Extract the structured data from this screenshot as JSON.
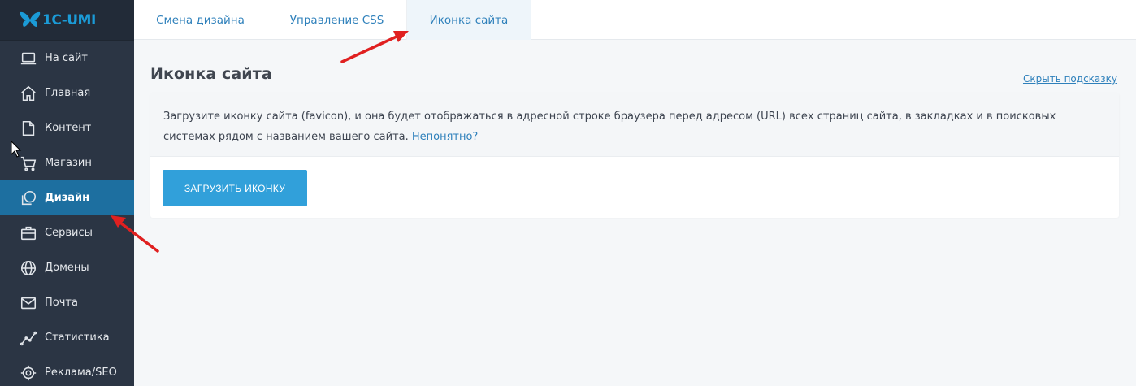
{
  "app": {
    "logo_text": "1C-UMI"
  },
  "sidebar": {
    "items": [
      {
        "label": "На сайт",
        "icon": "laptop-icon"
      },
      {
        "label": "Главная",
        "icon": "home-icon"
      },
      {
        "label": "Контент",
        "icon": "document-icon"
      },
      {
        "label": "Магазин",
        "icon": "cart-icon"
      },
      {
        "label": "Дизайн",
        "icon": "design-icon",
        "active": true
      },
      {
        "label": "Сервисы",
        "icon": "briefcase-icon"
      },
      {
        "label": "Домены",
        "icon": "globe-icon"
      },
      {
        "label": "Почта",
        "icon": "mail-icon"
      },
      {
        "label": "Статистика",
        "icon": "chart-line-icon"
      },
      {
        "label": "Реклама/SEO",
        "icon": "target-icon"
      }
    ]
  },
  "tabs": [
    {
      "label": "Смена дизайна"
    },
    {
      "label": "Управление CSS"
    },
    {
      "label": "Иконка сайта",
      "active": true
    }
  ],
  "main": {
    "title": "Иконка сайта",
    "hide_hint": "Скрыть подсказку",
    "hint_text": "Загрузите иконку сайта (favicon), и она будет отображаться в адресной строке браузера перед адресом (URL) всех страниц сайта, в закладках и в поисковых системах рядом с названием вашего сайта.",
    "hint_link": "Непонятно?",
    "upload_button": "ЗАГРУЗИТЬ ИКОНКУ"
  },
  "colors": {
    "sidebar_bg": "#2b3544",
    "active_bg": "#1d6fa0",
    "accent": "#31a0da",
    "link": "#2e80bb",
    "arrow": "#e02020"
  }
}
